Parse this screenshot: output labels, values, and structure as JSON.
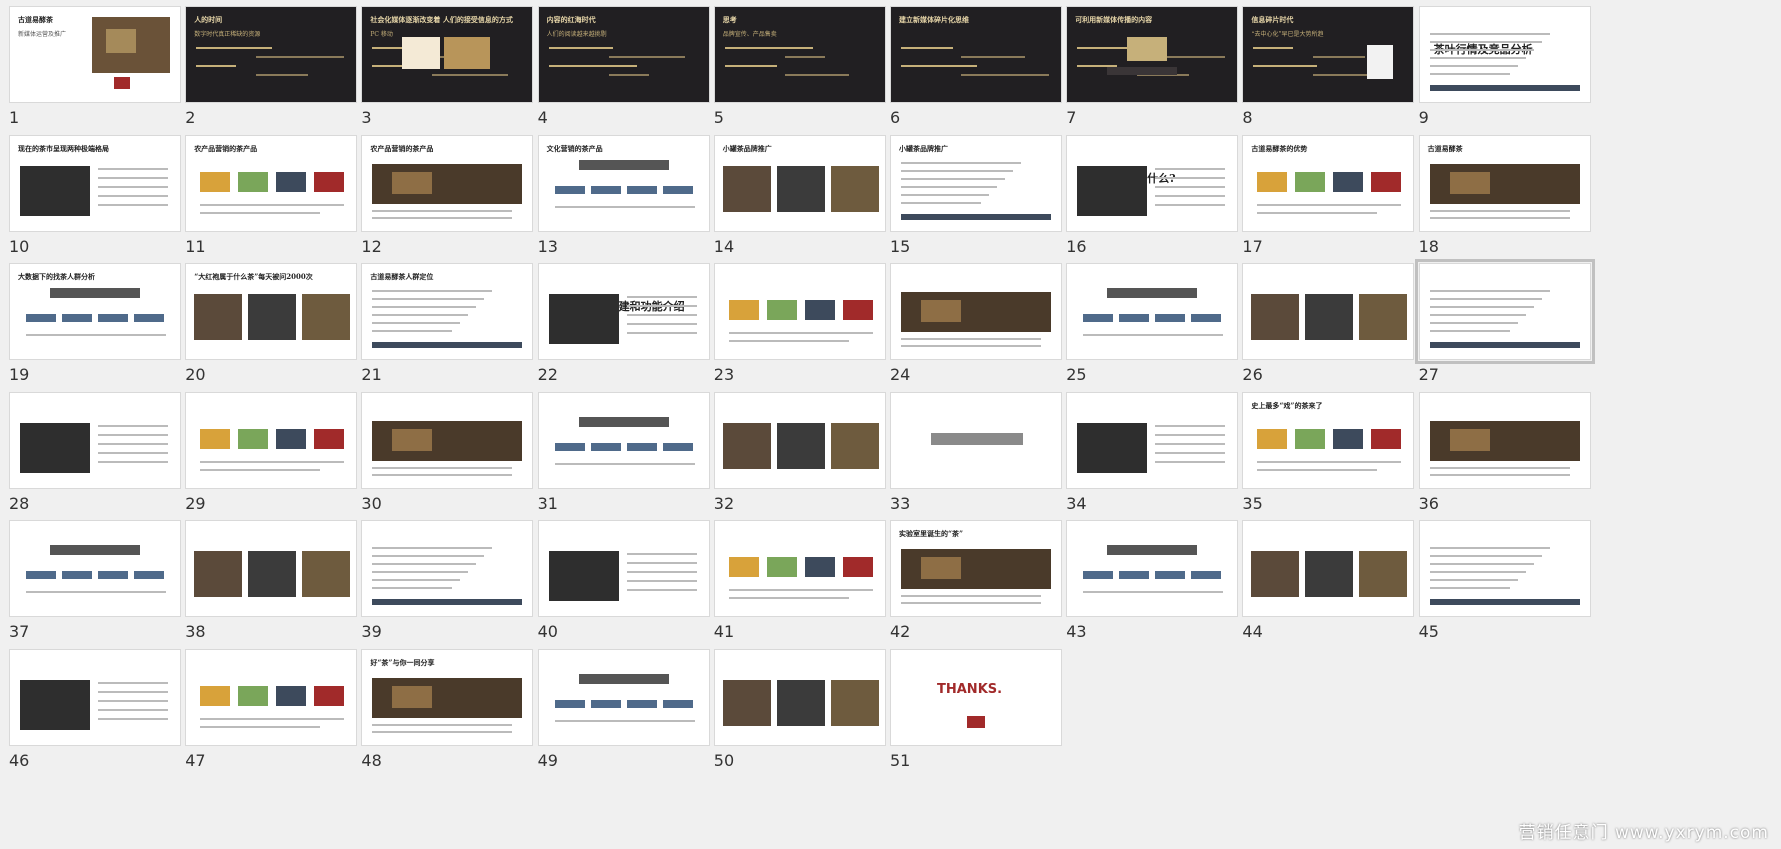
{
  "slides": [
    {
      "n": "1",
      "title": "古道易酵茶",
      "sub": "新媒体运营及推广"
    },
    {
      "n": "2",
      "title": "人的时间",
      "sub": "数字时代真正稀缺的资源"
    },
    {
      "n": "3",
      "title": "社会化媒体逐渐改变着 人们的接受信息的方式",
      "sub": "PC  移动"
    },
    {
      "n": "4",
      "title": "内容的红海时代",
      "sub": "人们的阅读越来越挑剔"
    },
    {
      "n": "5",
      "title": "思考",
      "sub": "品牌宣传、产品售卖"
    },
    {
      "n": "6",
      "title": "建立新媒体碎片化思维",
      "sub": ""
    },
    {
      "n": "7",
      "title": "可利用新媒体传播的内容",
      "sub": ""
    },
    {
      "n": "8",
      "title": "信息碎片时代",
      "sub": "“去中心化”早已是大势所趋"
    },
    {
      "n": "9",
      "title": "茶叶行情及竞品分析",
      "sub": ""
    },
    {
      "n": "10",
      "title": "现在的茶市呈现两种极端格局",
      "sub": ""
    },
    {
      "n": "11",
      "title": "农产品营销的茶产品",
      "sub": ""
    },
    {
      "n": "12",
      "title": "农产品营销的茶产品",
      "sub": ""
    },
    {
      "n": "13",
      "title": "文化营销的茶产品",
      "sub": ""
    },
    {
      "n": "14",
      "title": "小罐茶品牌推广",
      "sub": ""
    },
    {
      "n": "15",
      "title": "小罐茶品牌推广",
      "sub": ""
    },
    {
      "n": "16",
      "title": "古道易酵茶是什么?",
      "sub": ""
    },
    {
      "n": "17",
      "title": "古道易酵茶的优势",
      "sub": ""
    },
    {
      "n": "18",
      "title": "古道易酵茶",
      "sub": ""
    },
    {
      "n": "19",
      "title": "大数据下的找茶人群分析",
      "sub": ""
    },
    {
      "n": "20",
      "title": "“大红袍属于什么茶”每天被问2000次",
      "sub": ""
    },
    {
      "n": "21",
      "title": "古道易酵茶人群定位",
      "sub": ""
    },
    {
      "n": "22",
      "title": "微信及商城搭建和功能介绍",
      "sub": ""
    },
    {
      "n": "23",
      "title": "",
      "sub": ""
    },
    {
      "n": "24",
      "title": "",
      "sub": ""
    },
    {
      "n": "25",
      "title": "",
      "sub": ""
    },
    {
      "n": "26",
      "title": "",
      "sub": ""
    },
    {
      "n": "27",
      "title": "",
      "sub": ""
    },
    {
      "n": "28",
      "title": "",
      "sub": ""
    },
    {
      "n": "29",
      "title": "",
      "sub": ""
    },
    {
      "n": "30",
      "title": "",
      "sub": ""
    },
    {
      "n": "31",
      "title": "",
      "sub": ""
    },
    {
      "n": "32",
      "title": "",
      "sub": ""
    },
    {
      "n": "33",
      "title": "",
      "sub": ""
    },
    {
      "n": "34",
      "title": "",
      "sub": ""
    },
    {
      "n": "35",
      "title": "史上最多“戏”的茶来了",
      "sub": ""
    },
    {
      "n": "36",
      "title": "",
      "sub": ""
    },
    {
      "n": "37",
      "title": "",
      "sub": ""
    },
    {
      "n": "38",
      "title": "",
      "sub": ""
    },
    {
      "n": "39",
      "title": "",
      "sub": ""
    },
    {
      "n": "40",
      "title": "",
      "sub": ""
    },
    {
      "n": "41",
      "title": "",
      "sub": ""
    },
    {
      "n": "42",
      "title": "实验室里诞生的“茶”",
      "sub": ""
    },
    {
      "n": "43",
      "title": "",
      "sub": ""
    },
    {
      "n": "44",
      "title": "",
      "sub": ""
    },
    {
      "n": "45",
      "title": "",
      "sub": ""
    },
    {
      "n": "46",
      "title": "",
      "sub": ""
    },
    {
      "n": "47",
      "title": "",
      "sub": ""
    },
    {
      "n": "48",
      "title": "好“茶”与你一同分享",
      "sub": ""
    },
    {
      "n": "49",
      "title": "",
      "sub": ""
    },
    {
      "n": "50",
      "title": "",
      "sub": ""
    },
    {
      "n": "51",
      "title": "THANKS.",
      "sub": ""
    }
  ],
  "selected": "27",
  "watermark": "营销任意门 www.yxrym.com",
  "colors": {
    "gold": "#c6b07a",
    "dark": "#211f22",
    "accent": "#a12a2a"
  }
}
